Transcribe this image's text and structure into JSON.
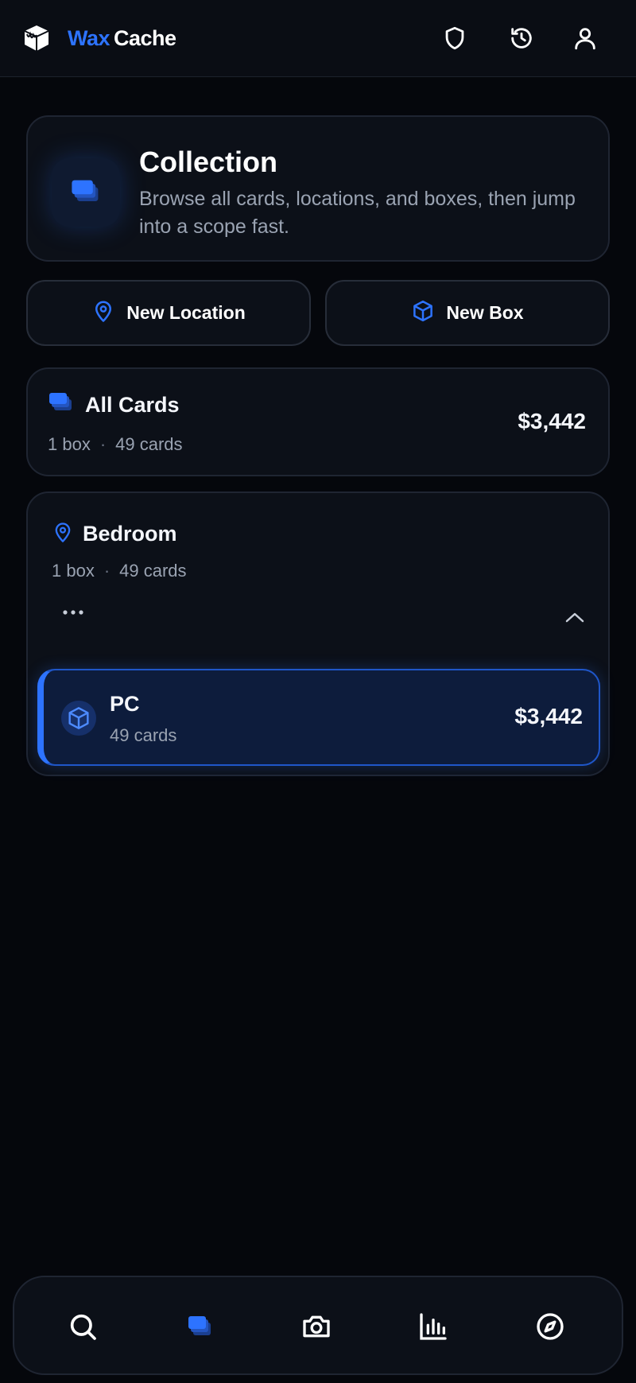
{
  "header": {
    "brand_first": "Wax",
    "brand_second": "Cache",
    "icons": [
      "shield-icon",
      "history-icon",
      "user-icon"
    ]
  },
  "hero": {
    "title": "Collection",
    "description": "Browse all cards, locations, and boxes, then jump into a scope fast.",
    "icon": "cards-stack-icon"
  },
  "actions": {
    "new_location_label": "New Location",
    "new_box_label": "New Box"
  },
  "all_cards": {
    "title": "All Cards",
    "boxes": "1 box",
    "cards": "49 cards",
    "value": "$3,442"
  },
  "locations": [
    {
      "title": "Bedroom",
      "boxes": "1 box",
      "cards": "49 cards",
      "boxes_list": [
        {
          "title": "PC",
          "cards": "49 cards",
          "value": "$3,442"
        }
      ]
    }
  ],
  "bottom_nav": {
    "items": [
      "search-icon",
      "cards-icon",
      "camera-icon",
      "stats-icon",
      "explore-icon"
    ],
    "active": "cards-icon"
  },
  "colors": {
    "accent": "#2d73ff",
    "background": "#05070c",
    "surface": "#0c1018",
    "text_muted": "#9aa3b2"
  }
}
